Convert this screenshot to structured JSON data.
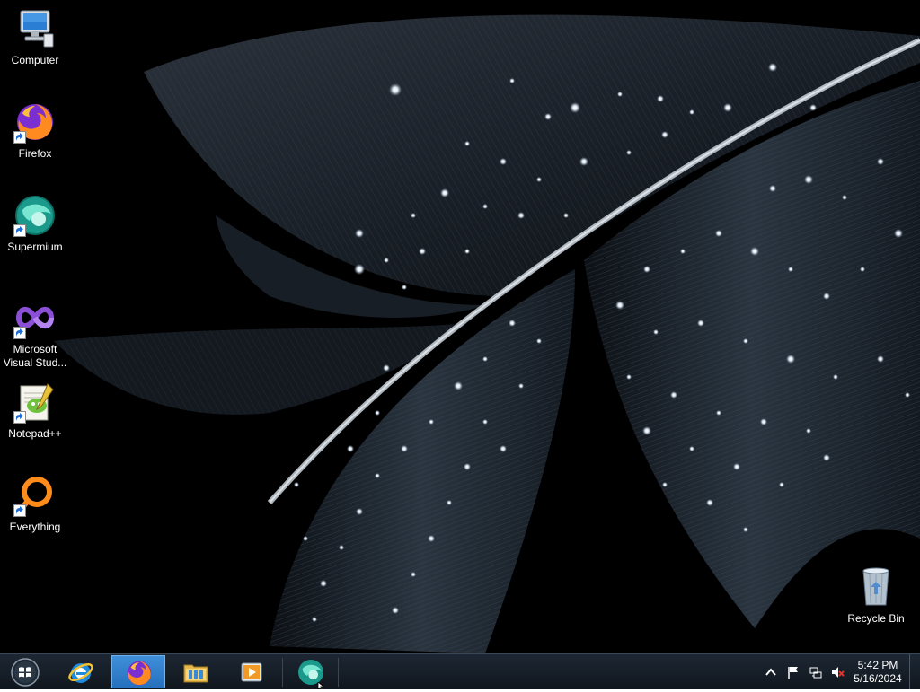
{
  "desktop": {
    "icons": [
      {
        "label": "Computer",
        "icon": "computer-icon"
      },
      {
        "label": "Firefox",
        "icon": "firefox-icon"
      },
      {
        "label": "Supermium",
        "icon": "supermium-icon"
      },
      {
        "label_line1": "Microsoft",
        "label_line2": "Visual Stud...",
        "icon": "visual-studio-icon"
      },
      {
        "label": "Notepad++",
        "icon": "notepadpp-icon"
      },
      {
        "label": "Everything",
        "icon": "everything-icon"
      }
    ],
    "recycle_bin": {
      "label": "Recycle Bin",
      "icon": "recycle-bin-icon"
    }
  },
  "taskbar": {
    "start": {
      "icon": "windows-start-icon"
    },
    "pinned": [
      {
        "name": "Internet Explorer",
        "icon": "ie-icon",
        "active": false
      },
      {
        "name": "Firefox",
        "icon": "firefox-icon",
        "active": true
      },
      {
        "name": "File Explorer",
        "icon": "folder-icon",
        "active": false
      },
      {
        "name": "Media Player",
        "icon": "media-player-icon",
        "active": false
      },
      {
        "name": "Supermium",
        "icon": "supermium-icon",
        "active": false
      }
    ],
    "tray": {
      "icons": [
        "chevron-up-icon",
        "flag-icon",
        "network-icon",
        "volume-muted-icon"
      ],
      "time": "5:42 PM",
      "date": "5/16/2024"
    }
  },
  "colors": {
    "taskbar_bg": "#141b23",
    "active_button": "#3a86d0",
    "desktop_bg": "#000000"
  }
}
